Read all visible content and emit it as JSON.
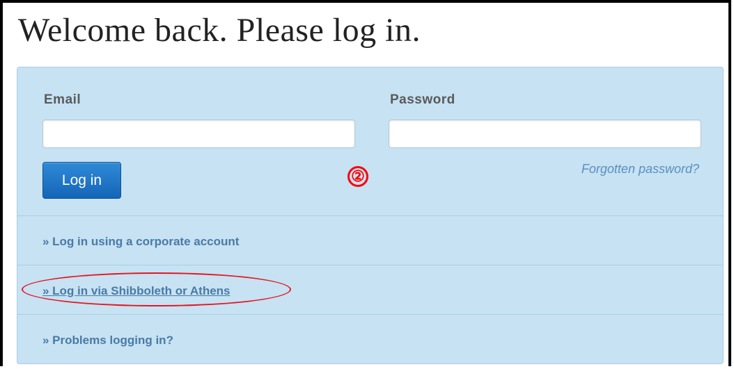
{
  "page": {
    "title": "Welcome back. Please log in."
  },
  "form": {
    "email_label": "Email",
    "email_value": "",
    "password_label": "Password",
    "password_value": "",
    "login_button": "Log in",
    "forgot_password": "Forgotten password?"
  },
  "options": [
    {
      "label": "» Log in using a corporate account"
    },
    {
      "label": "» Log in via Shibboleth or Athens"
    },
    {
      "label": "» Problems logging in?"
    }
  ],
  "annotations": {
    "step_marker": "②",
    "marker_color": "#ff0000",
    "highlight_color": "#e5171f"
  },
  "colors": {
    "panel_background": "#c6e2f3",
    "button_blue": "#1f74c7",
    "link_color": "#4a7aa5"
  }
}
